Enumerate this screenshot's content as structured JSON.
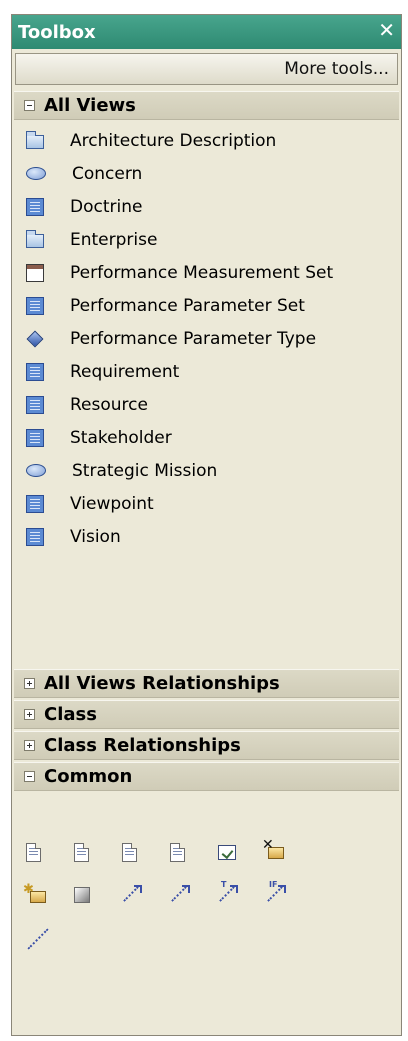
{
  "toolbox": {
    "title": "Toolbox",
    "close_glyph": "✕",
    "more_tools": "More tools..."
  },
  "sections": {
    "all_views": "All Views",
    "all_views_relationships": "All Views Relationships",
    "class": "Class",
    "class_relationships": "Class Relationships",
    "common": "Common"
  },
  "all_views_items": [
    {
      "label": "Architecture Description",
      "icon": "folder-icon"
    },
    {
      "label": "Concern",
      "icon": "ellipse-icon"
    },
    {
      "label": "Doctrine",
      "icon": "document-icon"
    },
    {
      "label": "Enterprise",
      "icon": "folder-icon"
    },
    {
      "label": "Performance Measurement Set",
      "icon": "measurement-set-icon"
    },
    {
      "label": "Performance Parameter Set",
      "icon": "document-icon"
    },
    {
      "label": "Performance Parameter Type",
      "icon": "diamond-icon"
    },
    {
      "label": "Requirement",
      "icon": "document-icon"
    },
    {
      "label": "Resource",
      "icon": "document-icon"
    },
    {
      "label": "Stakeholder",
      "icon": "document-icon"
    },
    {
      "label": "Strategic Mission",
      "icon": "ellipse-icon"
    },
    {
      "label": "Viewpoint",
      "icon": "document-icon"
    },
    {
      "label": "Vision",
      "icon": "document-icon"
    }
  ],
  "common_tools": {
    "row1": [
      "note-icon",
      "refresh-note-icon",
      "export-note-icon",
      "text-note-icon",
      "checkbox-icon",
      "remove-element-icon"
    ],
    "row2": [
      "new-element-icon",
      "gradient-box-icon",
      "dependency-arrow-icon",
      "trace-arrow-icon",
      "typed-link-icon",
      "conditional-link-icon"
    ],
    "row3": [
      "dashed-line-icon"
    ],
    "row2_tags": {
      "typed_link": "T",
      "conditional_link": "IF"
    }
  },
  "colors": {
    "title_bar": "#3b9a80",
    "panel_bg": "#ece9d8",
    "section_bg": "#d6d3bf",
    "icon_blue": "#5b8ad3"
  }
}
